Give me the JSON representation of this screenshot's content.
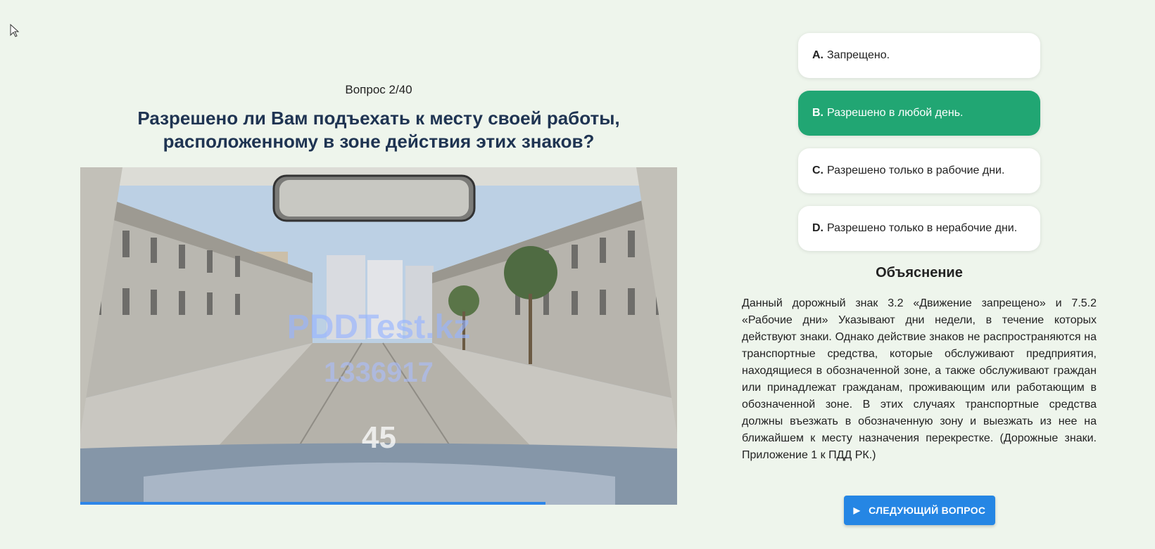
{
  "cursor": {
    "icon": "mouse-pointer-icon"
  },
  "question": {
    "counter": "Вопрос 2/40",
    "text": "Разрешено ли Вам подъехать к месту своей работы, расположенному в зоне действия этих знаков?"
  },
  "media": {
    "watermark_site": "PDDTest.kz",
    "watermark_id": "1336917",
    "speed": "45",
    "progress_fraction": 0.78
  },
  "options": [
    {
      "letter": "A.",
      "text": "Запрещено.",
      "selected": false
    },
    {
      "letter": "B.",
      "text": "Разрешено в любой день.",
      "selected": true
    },
    {
      "letter": "C.",
      "text": "Разрешено только в рабочие дни.",
      "selected": false
    },
    {
      "letter": "D.",
      "text": "Разрешено только в нерабочие дни.",
      "selected": false
    }
  ],
  "explanation": {
    "title": "Объяснение",
    "text": "Данный дорожный знак 3.2 «Движение запрещено» и 7.5.2 «Рабочие дни» Указывают дни недели, в течение которых действуют знаки. Однако действие знаков не распространяются на транспортные средства, которые обслуживают предприятия, находящиеся в обозначенной зоне, а также обслуживают граждан или принадлежат гражданам, проживающим или работающим в обозначенной зоне. В этих случаях транспортные средства должны въезжать в обозначенную зону и выезжать из нее на ближайшем к месту назначения перекрестке. (Дорожные знаки. Приложение 1 к ПДД РК.)"
  },
  "next_button": {
    "label": "СЛЕДУЮЩИЙ ВОПРОС",
    "icon": "play-icon"
  },
  "colors": {
    "selected": "#21a673",
    "accent": "#2586e4",
    "title": "#1f3452",
    "background": "#eef5ec"
  }
}
